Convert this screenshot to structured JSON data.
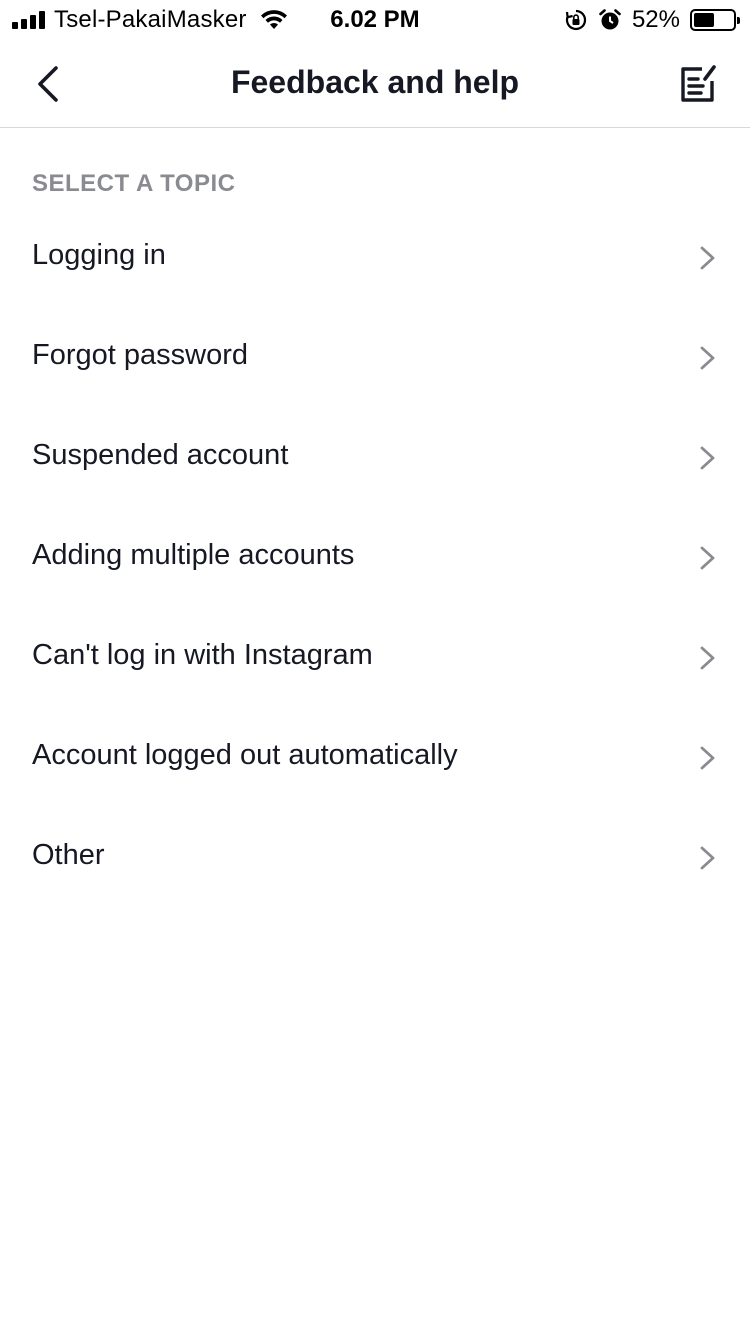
{
  "status_bar": {
    "carrier": "Tsel-PakaiMasker",
    "time": "6.02 PM",
    "battery_percent_label": "52%",
    "battery_level": 0.52,
    "icons": [
      "signal-icon",
      "wifi-icon",
      "rotation-lock-icon",
      "alarm-icon",
      "battery-icon"
    ]
  },
  "header": {
    "title": "Feedback and help",
    "back_icon": "chevron-left-icon",
    "action_icon": "compose-report-icon"
  },
  "topics": {
    "section_label": "SELECT A TOPIC",
    "items": [
      {
        "label": "Logging in"
      },
      {
        "label": "Forgot password"
      },
      {
        "label": "Suspended account"
      },
      {
        "label": "Adding multiple accounts"
      },
      {
        "label": "Can't log in with Instagram"
      },
      {
        "label": "Account logged out automatically"
      },
      {
        "label": "Other"
      }
    ]
  },
  "colors": {
    "text_primary": "#161823",
    "text_secondary": "#8a8b91",
    "divider": "#d8d8da",
    "chevron": "#8a8b91"
  }
}
